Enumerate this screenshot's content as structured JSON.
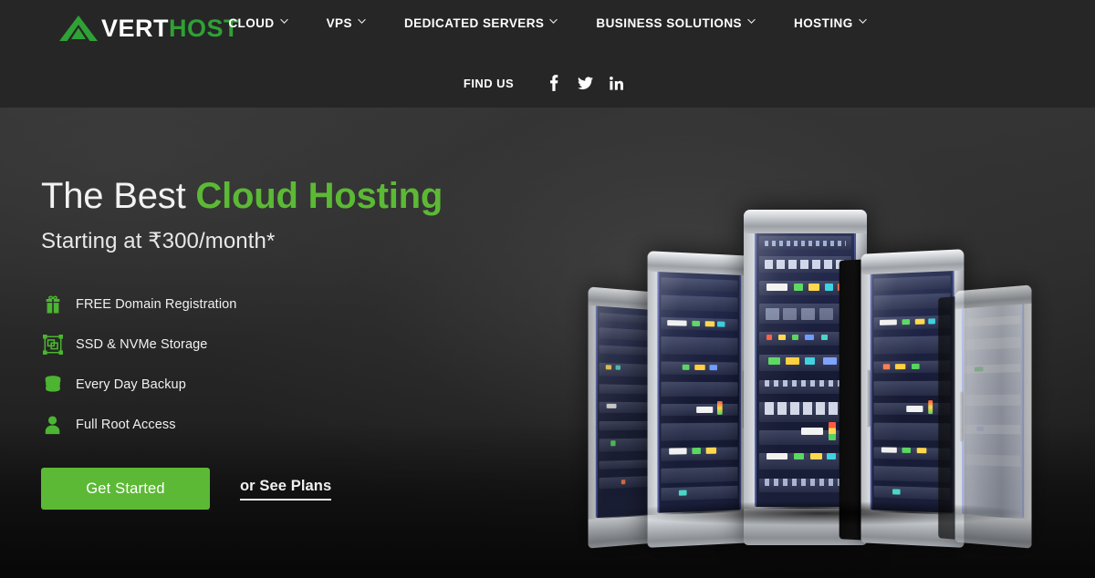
{
  "brand": {
    "name_part1": "VERT",
    "name_part2": "HOST",
    "logo_icon": "triangle-a-mark",
    "green": "#2fa135",
    "accent_green": "#5cb935"
  },
  "header": {
    "nav": [
      {
        "label": "CLOUD",
        "icon": "chevron-down-icon"
      },
      {
        "label": "VPS",
        "icon": "chevron-down-icon"
      },
      {
        "label": "DEDICATED SERVERS",
        "icon": "chevron-down-icon"
      },
      {
        "label": "BUSINESS SOLUTIONS",
        "icon": "chevron-down-icon"
      },
      {
        "label": "HOSTING",
        "icon": "chevron-down-icon"
      }
    ],
    "find_us_label": "FIND US",
    "social": [
      {
        "name": "facebook-icon",
        "label": "f"
      },
      {
        "name": "twitter-icon",
        "label": "twitter"
      },
      {
        "name": "linkedin-icon",
        "label": "in"
      }
    ],
    "background": "#262626"
  },
  "hero": {
    "headline_plain": "The Best ",
    "headline_accent": "Cloud Hosting",
    "subhead": "Starting at ₹300/month*",
    "features": [
      {
        "icon": "gift-icon",
        "label": "FREE Domain Registration"
      },
      {
        "icon": "resize-frame-icon",
        "label": "SSD & NVMe Storage"
      },
      {
        "icon": "database-stack-icon",
        "label": "Every Day Backup"
      },
      {
        "icon": "user-icon",
        "label": "Full Root Access"
      }
    ],
    "cta_primary": "Get Started",
    "cta_secondary": "or See Plans",
    "artwork": "server-rack-array"
  }
}
